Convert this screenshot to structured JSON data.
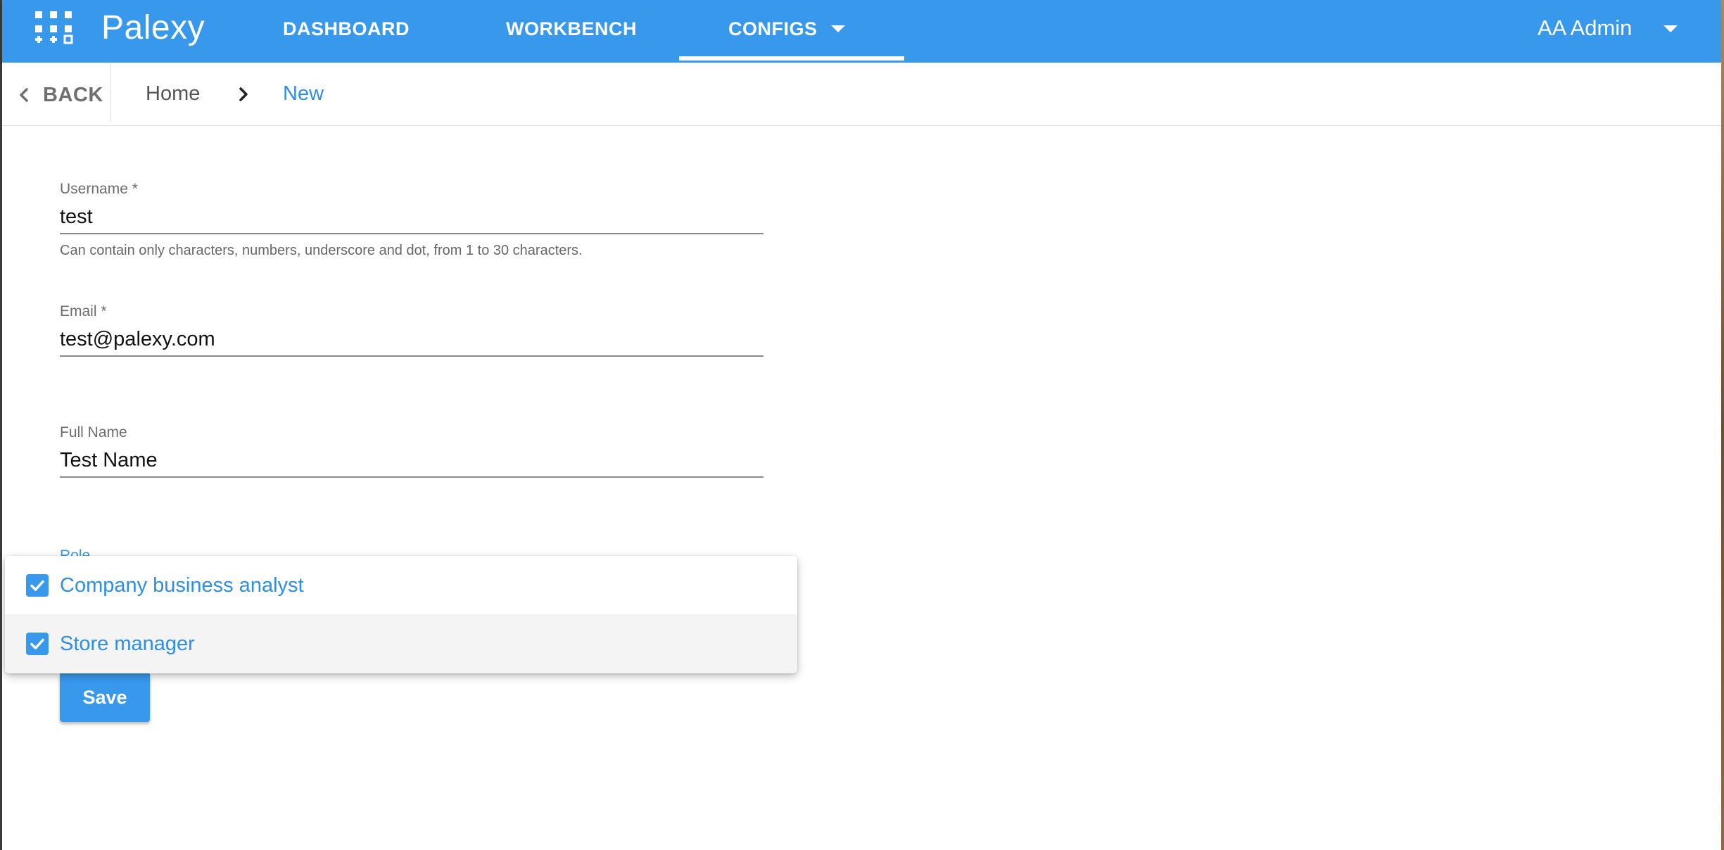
{
  "app": {
    "brand": "Palexy",
    "nav": [
      {
        "label": "DASHBOARD"
      },
      {
        "label": "WORKBENCH"
      },
      {
        "label": "CONFIGS",
        "active": true
      }
    ],
    "user": "AA Admin",
    "colors": {
      "primary": "#3899ec",
      "link": "#2f8ee0"
    }
  },
  "breadcrumb": {
    "back_label": "BACK",
    "items": [
      "Home",
      "New"
    ]
  },
  "form": {
    "username": {
      "label": "Username *",
      "value": "test",
      "hint": "Can contain only characters, numbers, underscore and dot, from 1 to 30 characters."
    },
    "email": {
      "label": "Email *",
      "value": "test@palexy.com"
    },
    "full_name": {
      "label": "Full Name",
      "value": "Test Name"
    },
    "role": {
      "label": "Role"
    },
    "save_label": "Save"
  },
  "role_menu": {
    "options": [
      {
        "label": "Company business analyst",
        "checked": true
      },
      {
        "label": "Store manager",
        "checked": true
      }
    ]
  },
  "icons": [
    "apps-grid-icon",
    "chevron-down-icon",
    "chevron-left-icon",
    "chevron-right-icon",
    "checkbox-checked-icon"
  ]
}
